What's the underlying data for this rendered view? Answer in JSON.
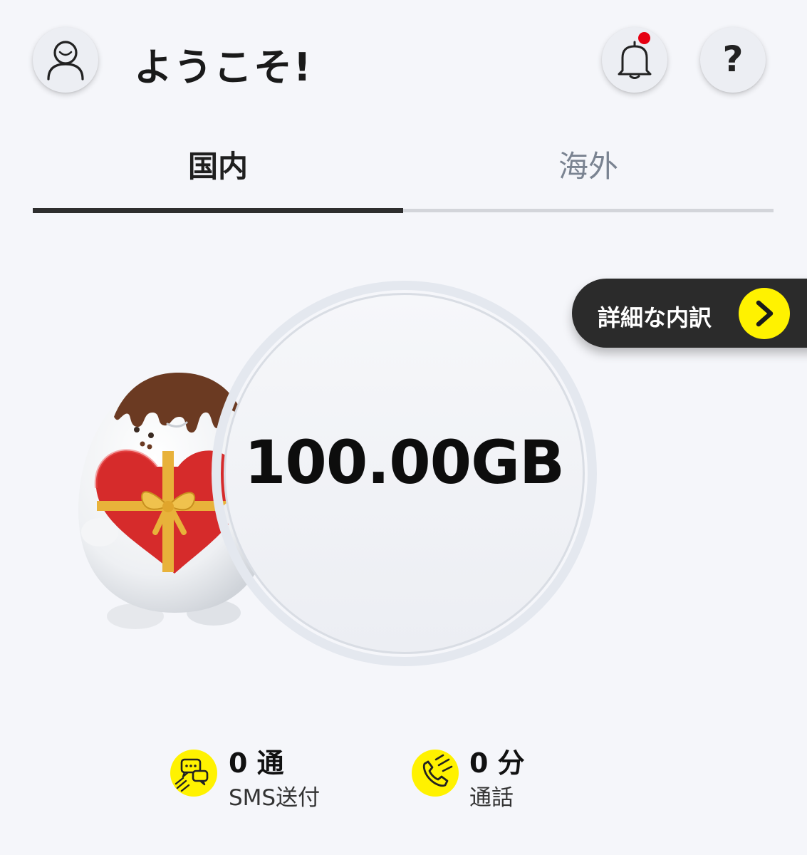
{
  "header": {
    "welcome": "ようこそ!",
    "help_label": "?",
    "avatar_icon": "user-avatar-icon",
    "bell_icon": "bell-icon",
    "has_notification": true
  },
  "tabs": [
    {
      "label": "国内",
      "active": true
    },
    {
      "label": "海外",
      "active": false
    }
  ],
  "detail_button": {
    "label": "詳細な内訳",
    "icon": "chevron-right-icon"
  },
  "data_remaining": "100.00GB",
  "stats": {
    "sms": {
      "value": "0 通",
      "label": "SMS送付",
      "icon": "sms-chat-icon"
    },
    "call": {
      "value": "0 分",
      "label": "通話",
      "icon": "phone-call-icon"
    }
  },
  "colors": {
    "accent": "#fff200",
    "notification": "#e60012",
    "active_tab": "#2e2e2e",
    "inactive_tab": "#7a8391",
    "background": "#f5f6fa"
  }
}
